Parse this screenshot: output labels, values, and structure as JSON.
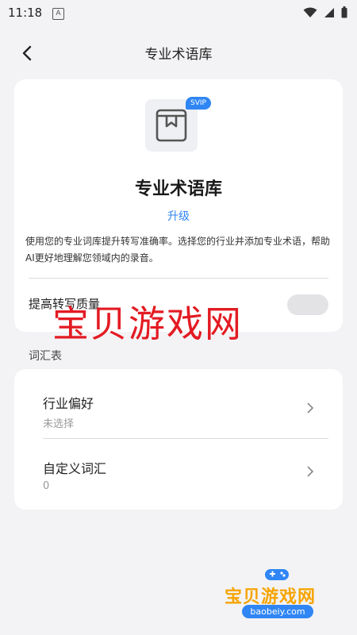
{
  "status_bar": {
    "time": "11:18",
    "notification_icon": "A"
  },
  "nav": {
    "title": "专业术语库"
  },
  "feature_card": {
    "badge": "SVIP",
    "title": "专业术语库",
    "upgrade_label": "升级",
    "description": "使用您的专业词库提升转写准确率。选择您的行业并添加专业术语，帮助AI更好地理解您领域内的录音。",
    "toggle_label": "提高转写质量",
    "toggle_on": false
  },
  "vocab_section": {
    "label": "词汇表",
    "items": [
      {
        "title": "行业偏好",
        "value": "未选择"
      },
      {
        "title": "自定义词汇",
        "value": "0"
      }
    ]
  },
  "watermark": {
    "text": "宝贝游戏网",
    "logo_text": "宝贝游戏网",
    "logo_domain": "baobeiy.com"
  },
  "colors": {
    "accent": "#2f86f4",
    "watermark_red": "#e31b23",
    "logo_orange": "#f6a400"
  }
}
